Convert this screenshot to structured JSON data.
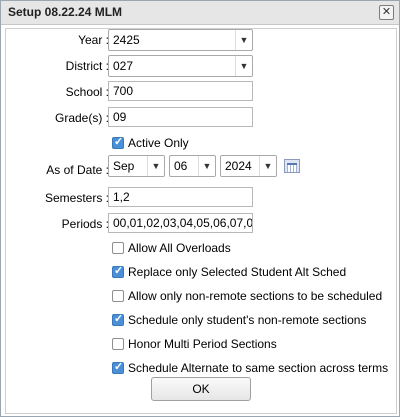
{
  "window": {
    "title": "Setup 08.22.24 MLM",
    "close_glyph": "✕"
  },
  "year": {
    "label": "Year :",
    "value": "2425"
  },
  "district": {
    "label": "District :",
    "value": "027"
  },
  "school": {
    "label": "School :",
    "value": "700"
  },
  "grades": {
    "label": "Grade(s) :",
    "value": "09"
  },
  "active_only": {
    "label": "Active Only",
    "checked": true
  },
  "as_of_date": {
    "label": "As of Date :",
    "month": "Sep",
    "day": "06",
    "year": "2024",
    "icon": "calendar-icon"
  },
  "semesters": {
    "label": "Semesters :",
    "value": "1,2"
  },
  "periods": {
    "label": "Periods :",
    "value": "00,01,02,03,04,05,06,07,0..."
  },
  "options": [
    {
      "label": "Allow All Overloads",
      "checked": false
    },
    {
      "label": "Replace only Selected Student Alt Sched",
      "checked": true
    },
    {
      "label": "Allow only non-remote sections to be scheduled",
      "checked": false
    },
    {
      "label": "Schedule only student's non-remote sections",
      "checked": true
    },
    {
      "label": "Honor Multi Period Sections",
      "checked": false
    },
    {
      "label": "Schedule Alternate to same section across terms",
      "checked": true
    }
  ],
  "ok_label": "OK",
  "colors": {
    "checkbox_checked": "#4a90d9",
    "titlebar": "#e6e6e6"
  }
}
